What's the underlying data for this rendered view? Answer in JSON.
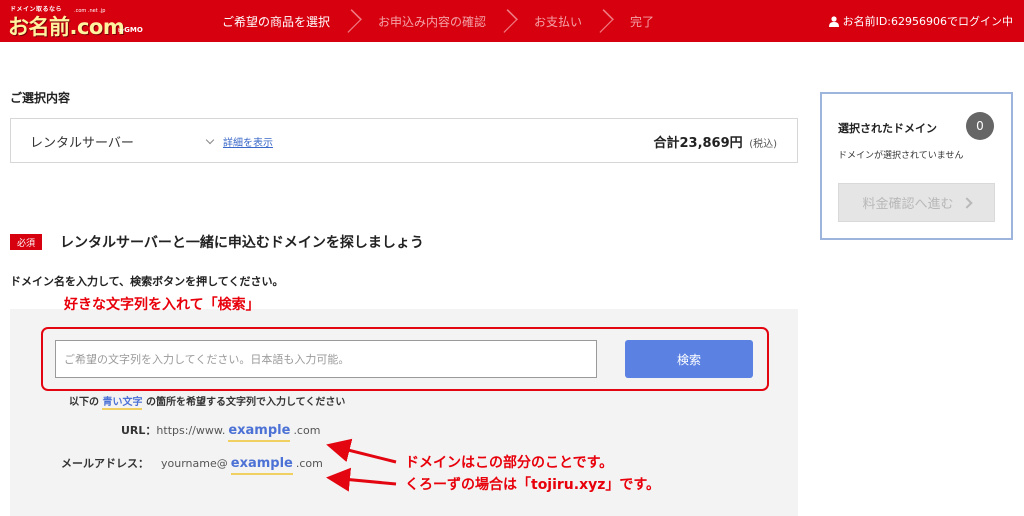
{
  "header": {
    "logo": {
      "tagline": "ドメイン取るなら",
      "main": "お名前.com",
      "tlds": ".com .net .jp",
      "gmo_prefix": "by",
      "gmo": "GMO"
    },
    "steps": [
      {
        "label": "ご希望の商品を選択",
        "active": true
      },
      {
        "label": "お申込み内容の確認",
        "active": false
      },
      {
        "label": "お支払い",
        "active": false
      },
      {
        "label": "完了",
        "active": false
      }
    ],
    "user_text": "お名前ID:62956906でログイン中"
  },
  "selection": {
    "title": "ご選択内容",
    "item_name": "レンタルサーバー",
    "detail_link": "詳細を表示",
    "total_label": "合計23,869円",
    "tax_label": "(税込)"
  },
  "panel": {
    "title": "選択されたドメイン",
    "count": "0",
    "note": "ドメインが選択されていません",
    "button_label": "料金確認へ進む"
  },
  "domain_search": {
    "required_badge": "必須",
    "title": "レンタルサーバーと一緒に申込むドメインを探しましょう",
    "instruction": "ドメイン名を入力して、検索ボタンを押してください。",
    "annotation_top": "好きな文字列を入れて「検索」",
    "input_placeholder": "ご希望の文字列を入力してください。日本語も入力可能。",
    "input_value": "",
    "search_button": "検索",
    "hint_before": "以下の",
    "hint_blue": "青い文字",
    "hint_after": "の箇所を希望する文字列で入力してください",
    "url_label": "URL：",
    "url_prefix": "https://www.",
    "url_highlight": "example",
    "url_suffix": ".com",
    "mail_label": "メールアドレス：",
    "mail_prefix": "yourname@",
    "mail_highlight": "example",
    "mail_suffix": ".com",
    "annotation_domain": "ドメインはこの部分のことです。",
    "annotation_example": "くろーずの場合は「tojiru.xyz」です。"
  },
  "colors": {
    "header_red": "#d7000f",
    "annotation_red": "#e8000b",
    "search_blue": "#5b82e3",
    "highlight_blue": "#4d72d6",
    "panel_border": "#9db4dc",
    "underline_yellow": "#f0d060"
  }
}
